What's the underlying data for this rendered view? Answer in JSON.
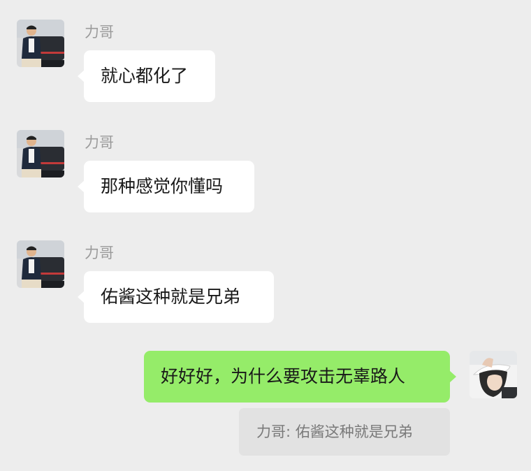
{
  "messages": [
    {
      "sender": "力哥",
      "text": "就心都化了",
      "direction": "incoming"
    },
    {
      "sender": "力哥",
      "text": "那种感觉你懂吗",
      "direction": "incoming"
    },
    {
      "sender": "力哥",
      "text": "佑酱这种就是兄弟",
      "direction": "incoming"
    },
    {
      "text": "好好好，为什么要攻击无辜路人",
      "direction": "outgoing"
    }
  ],
  "reply_quote": {
    "text": "力哥: 佑酱这种就是兄弟"
  },
  "colors": {
    "background": "#ededed",
    "incoming_bubble": "#ffffff",
    "outgoing_bubble": "#95ec69",
    "quote_background": "#e2e2e2",
    "sender_name": "#9b9b9b"
  },
  "icons": {
    "contact_avatar": "avatar-man-with-car",
    "self_avatar": "avatar-woman-with-hat"
  }
}
